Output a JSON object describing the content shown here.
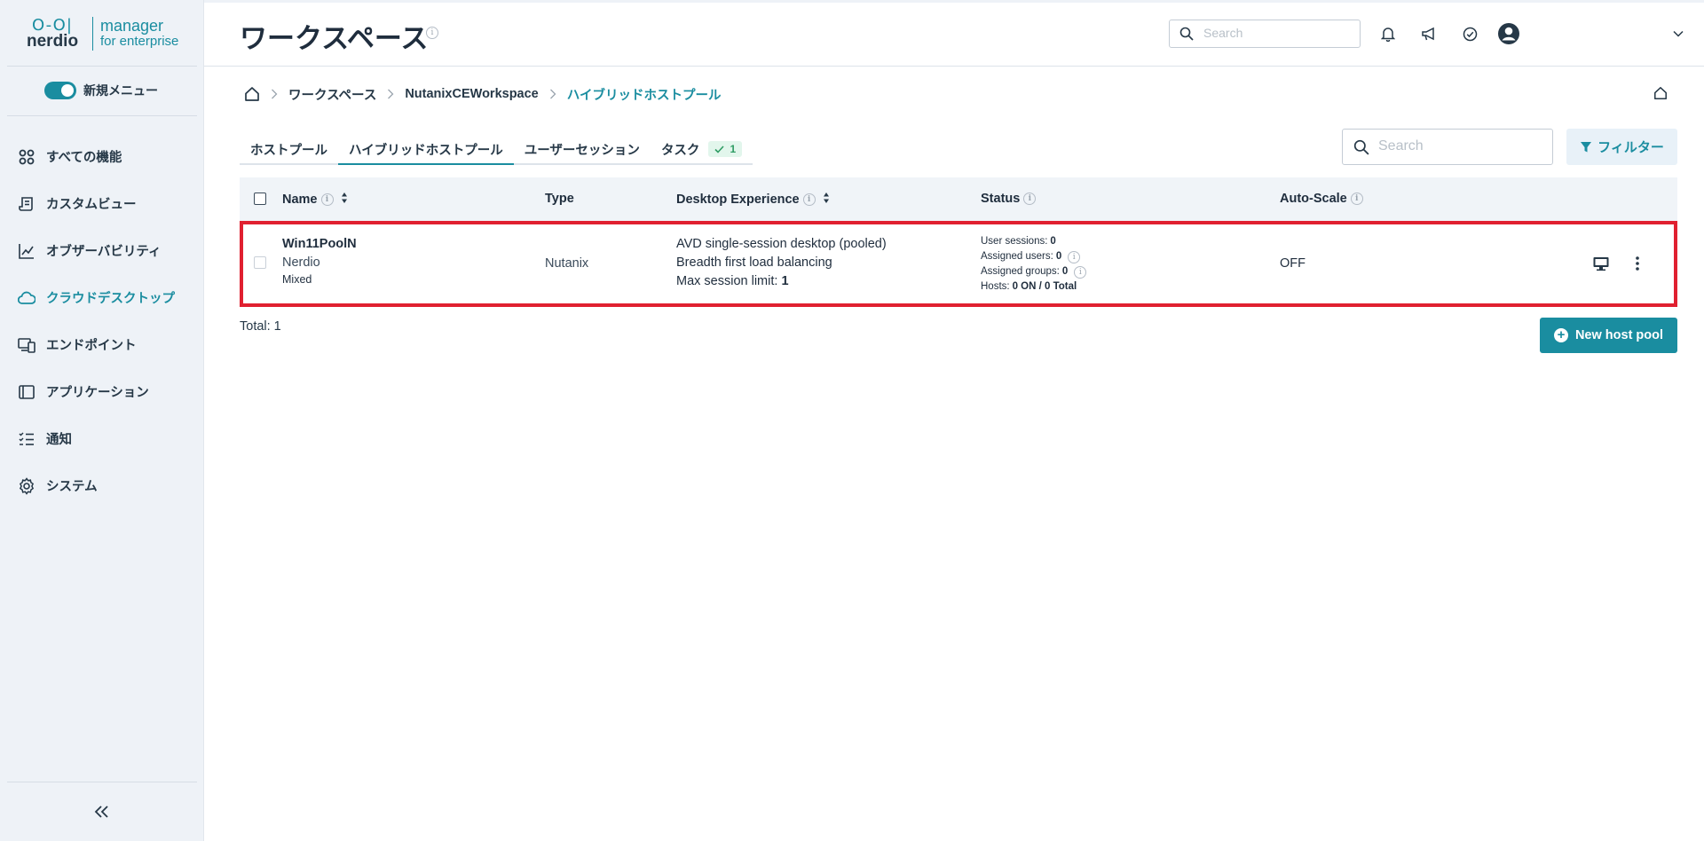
{
  "brand": {
    "logo_word": "nerdio",
    "logo_line1": "manager",
    "logo_line2": "for enterprise"
  },
  "sidebar": {
    "toggle_label": "新規メニュー",
    "items": [
      {
        "label": "すべての機能",
        "icon": "grid-icon",
        "active": false
      },
      {
        "label": "カスタムビュー",
        "icon": "scroll-icon",
        "active": false
      },
      {
        "label": "オブザーバビリティ",
        "icon": "chart-line-icon",
        "active": false
      },
      {
        "label": "クラウドデスクトップ",
        "icon": "cloud-icon",
        "active": true
      },
      {
        "label": "エンドポイント",
        "icon": "devices-icon",
        "active": false
      },
      {
        "label": "アプリケーション",
        "icon": "app-window-icon",
        "active": false
      },
      {
        "label": "通知",
        "icon": "checklist-icon",
        "active": false
      },
      {
        "label": "システム",
        "icon": "gear-icon",
        "active": false
      }
    ]
  },
  "header": {
    "title": "ワークスペース",
    "search_placeholder": "Search"
  },
  "breadcrumb": {
    "items": [
      "ワークスペース",
      "NutanixCEWorkspace"
    ],
    "current": "ハイブリッドホストプール"
  },
  "tabs": [
    {
      "label": "ホストプール",
      "active": false
    },
    {
      "label": "ハイブリッドホストプール",
      "active": true
    },
    {
      "label": "ユーザーセッション",
      "active": false
    },
    {
      "label": "タスク",
      "active": false,
      "badge": "1"
    }
  ],
  "toolbar": {
    "search_placeholder": "Search",
    "filter_label": "フィルター"
  },
  "table": {
    "columns": {
      "name": "Name",
      "type": "Type",
      "desktop_experience": "Desktop Experience",
      "status": "Status",
      "autoscale": "Auto-Scale"
    },
    "rows": [
      {
        "name": "Win11PoolN",
        "owner": "Nerdio",
        "mode": "Mixed",
        "type": "Nutanix",
        "experience_line1": "AVD single-session desktop (pooled)",
        "experience_line2": "Breadth first load balancing",
        "session_limit_label": "Max session limit:",
        "session_limit_value": "1",
        "user_sessions_label": "User sessions:",
        "user_sessions_value": "0",
        "assigned_users_label": "Assigned users:",
        "assigned_users_value": "0",
        "assigned_groups_label": "Assigned groups:",
        "assigned_groups_value": "0",
        "hosts_label": "Hosts:",
        "hosts_value": "0 ON / 0 Total",
        "autoscale": "OFF"
      }
    ]
  },
  "footer": {
    "total": "Total: 1",
    "new_button": "New host pool"
  },
  "colors": {
    "accent": "#1a8da0",
    "highlight_border": "#e02030",
    "sidebar_bg": "#eef2f7"
  }
}
